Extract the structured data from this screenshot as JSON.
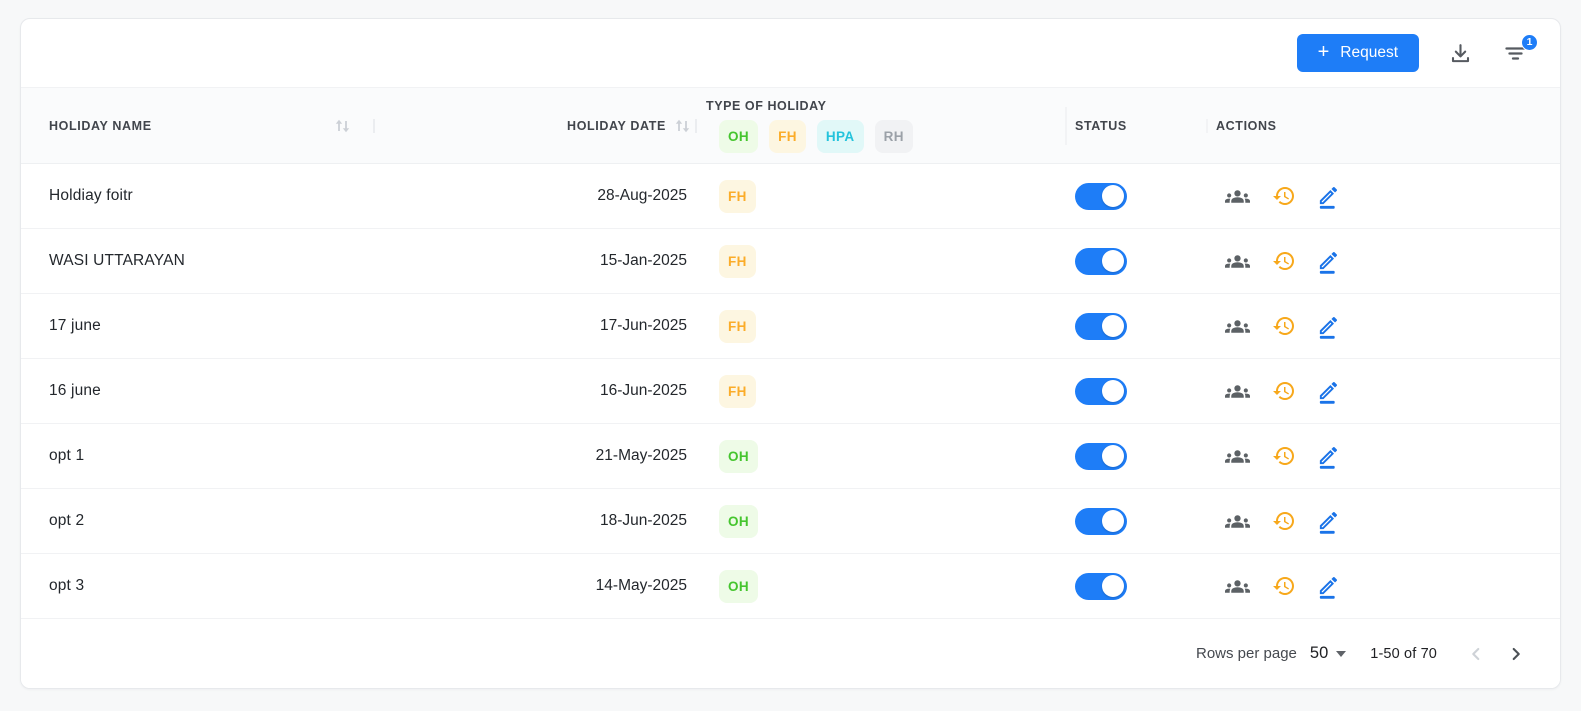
{
  "toolbar": {
    "request_button_plus": "+",
    "request_button_label": "Request",
    "filter_badge_count": "1"
  },
  "table": {
    "headers": {
      "holiday_name": "HOLIDAY NAME",
      "holiday_date": "HOLIDAY DATE",
      "type_of_holiday": "TYPE OF HOLIDAY",
      "status": "STATUS",
      "actions": "ACTIONS"
    },
    "type_legend": [
      {
        "code": "OH",
        "text_color": "#45c52e",
        "bg_color": "#eefbe7"
      },
      {
        "code": "FH",
        "text_color": "#fbac29",
        "bg_color": "#fdf6e1"
      },
      {
        "code": "HPA",
        "text_color": "#23c3dc",
        "bg_color": "#e1f8f8"
      },
      {
        "code": "RH",
        "text_color": "#9ba1a8",
        "bg_color": "#f1f2f4"
      }
    ],
    "rows": [
      {
        "name": "Holdiay foitr",
        "date": "28-Aug-2025",
        "type": "FH",
        "status_on": true
      },
      {
        "name": "WASI UTTARAYAN",
        "date": "15-Jan-2025",
        "type": "FH",
        "status_on": true
      },
      {
        "name": "17 june",
        "date": "17-Jun-2025",
        "type": "FH",
        "status_on": true
      },
      {
        "name": "16 june",
        "date": "16-Jun-2025",
        "type": "FH",
        "status_on": true
      },
      {
        "name": "opt 1",
        "date": "21-May-2025",
        "type": "OH",
        "status_on": true
      },
      {
        "name": "opt 2",
        "date": "18-Jun-2025",
        "type": "OH",
        "status_on": true
      },
      {
        "name": "opt 3",
        "date": "14-May-2025",
        "type": "OH",
        "status_on": true
      }
    ]
  },
  "pagination": {
    "rows_per_page_label": "Rows per page",
    "rows_per_page_value": "50",
    "range_text": "1-50 of 70"
  },
  "icons": {
    "download": "download-icon",
    "filter": "filter-list-icon",
    "sort": "sort-arrows-icon",
    "assign": "groups-icon",
    "history": "history-icon",
    "edit": "edit-pencil-icon",
    "prev": "chevron-left-icon",
    "next": "chevron-right-icon"
  },
  "colors": {
    "primary_blue": "#1e7df7",
    "toggle_on": "#1e7df7",
    "history_icon": "#f7a81b",
    "edit_icon": "#1a73e8",
    "muted_icon": "#5c6165"
  }
}
